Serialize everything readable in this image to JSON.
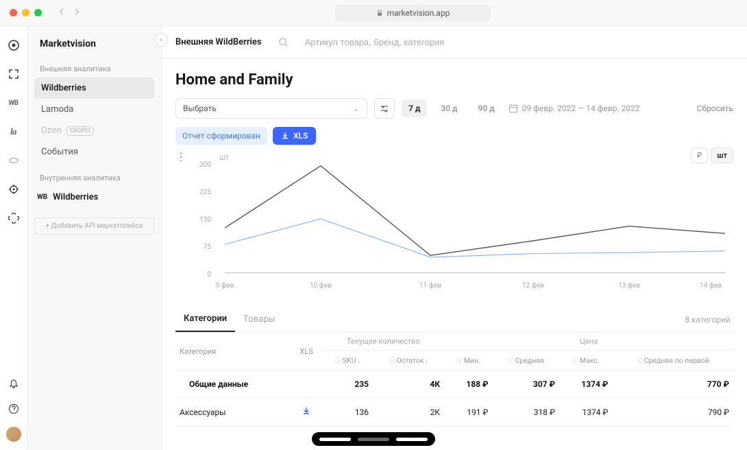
{
  "browser": {
    "url": "marketvision.app"
  },
  "brand": "Marketvision",
  "rail": {
    "wb": "WB",
    "la": "la"
  },
  "sidebar": {
    "section_external": "Внешняя аналитика",
    "items": [
      {
        "label": "Wildberries"
      },
      {
        "label": "Lamoda"
      },
      {
        "label": "Ozon",
        "soon": "СКОРО"
      },
      {
        "label": "События"
      }
    ],
    "section_internal": "Внутренняя аналитика",
    "internal_wb_icon": "WB",
    "internal_wb": "Wildberries",
    "add_api": "+   Добавить API маркетплейса"
  },
  "topbar": {
    "breadcrumb": "Внешняя WildBerries",
    "search_placeholder": "Артикул товара, бренд, категория"
  },
  "page": {
    "title": "Home and Family",
    "select_placeholder": "Выбрать",
    "ranges": {
      "d7": "7 д",
      "d30": "30 д",
      "d90": "90 д"
    },
    "date_range": "09 февр. 2022 — 14 февр. 2022",
    "reset": "Сбросить",
    "report_generated": "Отчет сформирован",
    "xls_label": "XLS",
    "unit_rub": "₽",
    "unit_pcs": "шт",
    "axis_unit": "ШТ"
  },
  "chart_data": {
    "type": "line",
    "x": [
      "9 фев",
      "10 фев",
      "11 фев",
      "12 фев",
      "13 фев",
      "14 фев"
    ],
    "series": [
      {
        "name": "main",
        "values": [
          125,
          295,
          50,
          90,
          130,
          110
        ]
      },
      {
        "name": "blue",
        "values": [
          80,
          150,
          45,
          55,
          58,
          62
        ]
      },
      {
        "name": "base",
        "values": [
          3,
          3,
          3,
          3,
          3,
          3
        ]
      }
    ],
    "ylim": [
      0,
      300
    ],
    "yticks": [
      0,
      75,
      150,
      225,
      300
    ],
    "ylabel": "",
    "xlabel": ""
  },
  "tabs": {
    "categories": "Категории",
    "products": "Товары",
    "count": "8 категорий"
  },
  "table": {
    "headers": {
      "category": "Категория",
      "xls": "XLS",
      "qty_group": "Текущее количество",
      "price_group": "Цена",
      "sku": "SKU",
      "stock": "Остаток",
      "min": "Мин.",
      "avg": "Средняя",
      "max": "Макс.",
      "avg_first": "Средняя по первой"
    },
    "rows": [
      {
        "category": "Общие данные",
        "total": true,
        "sku": "235",
        "stock": "4К",
        "min": "188 ₽",
        "avg": "307 ₽",
        "max": "1374 ₽",
        "avg_first": "770 ₽"
      },
      {
        "category": "Аксессуары",
        "sku": "136",
        "stock": "2К",
        "min": "191 ₽",
        "avg": "318 ₽",
        "max": "1374 ₽",
        "avg_first": "790 ₽"
      }
    ]
  }
}
